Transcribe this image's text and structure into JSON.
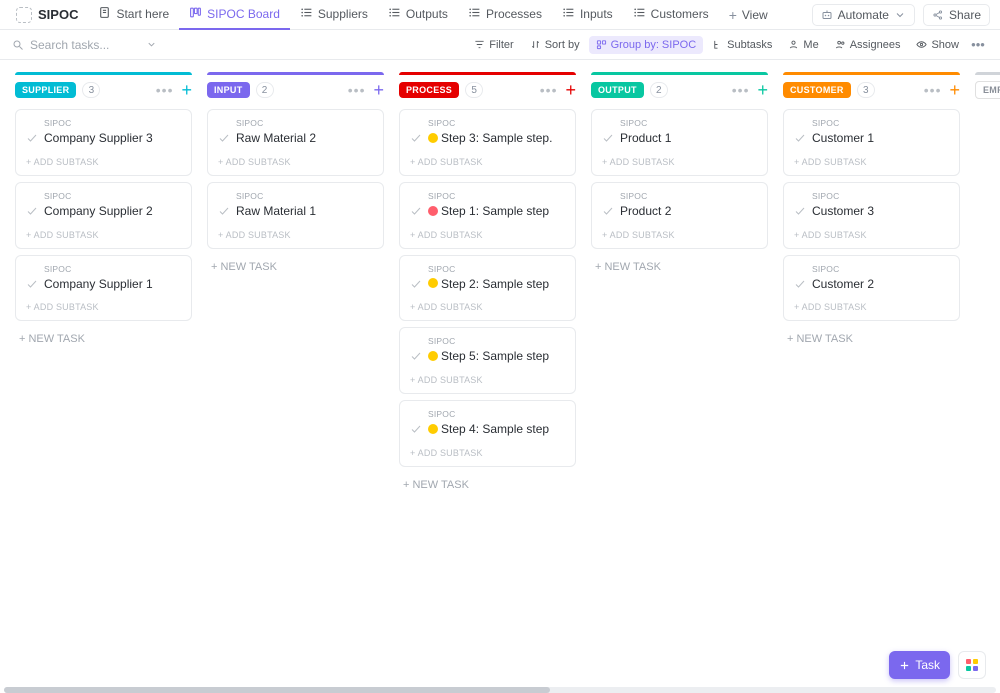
{
  "header": {
    "space_name": "SIPOC",
    "views": [
      {
        "label": "Start here",
        "type": "doc"
      },
      {
        "label": "SIPOC Board",
        "type": "board",
        "active": true
      },
      {
        "label": "Suppliers",
        "type": "list"
      },
      {
        "label": "Outputs",
        "type": "list"
      },
      {
        "label": "Processes",
        "type": "list"
      },
      {
        "label": "Inputs",
        "type": "list"
      },
      {
        "label": "Customers",
        "type": "list"
      }
    ],
    "add_view_label": "View",
    "automate_label": "Automate",
    "share_label": "Share"
  },
  "filters": {
    "search_placeholder": "Search tasks...",
    "filter": "Filter",
    "sort": "Sort by",
    "group": "Group by: SIPOC",
    "subtasks": "Subtasks",
    "me": "Me",
    "assignees": "Assignees",
    "show": "Show"
  },
  "ui": {
    "add_subtask": "ADD SUBTASK",
    "new_task": "NEW TASK",
    "crumb": "SIPOC"
  },
  "columns": [
    {
      "id": "supplier",
      "label": "SUPPLIER",
      "count": "3",
      "color": "#02bcd4",
      "plus": "#02bcd4",
      "cards": [
        {
          "title": "Company Supplier 3"
        },
        {
          "title": "Company Supplier 2"
        },
        {
          "title": "Company Supplier 1"
        }
      ]
    },
    {
      "id": "input",
      "label": "INPUT",
      "count": "2",
      "color": "#7b68ee",
      "plus": "#7b68ee",
      "cards": [
        {
          "title": "Raw Material 2"
        },
        {
          "title": "Raw Material 1"
        }
      ]
    },
    {
      "id": "process",
      "label": "PROCESS",
      "count": "5",
      "color": "#e50000",
      "plus": "#e50000",
      "cards": [
        {
          "title": "Step 3: Sample step.",
          "pri": "#ffcc00"
        },
        {
          "title": "Step 1: Sample step",
          "pri": "#ff5e6c"
        },
        {
          "title": "Step 2: Sample step",
          "pri": "#ffcc00"
        },
        {
          "title": "Step 5: Sample step",
          "pri": "#ffcc00"
        },
        {
          "title": "Step 4: Sample step",
          "pri": "#ffcc00"
        }
      ]
    },
    {
      "id": "output",
      "label": "OUTPUT",
      "count": "2",
      "color": "#08c7a1",
      "plus": "#08c7a1",
      "cards": [
        {
          "title": "Product 1"
        },
        {
          "title": "Product 2"
        }
      ]
    },
    {
      "id": "customer",
      "label": "CUSTOMER",
      "count": "3",
      "color": "#ff8b00",
      "plus": "#ff8b00",
      "cards": [
        {
          "title": "Customer 1"
        },
        {
          "title": "Customer 3"
        },
        {
          "title": "Customer 2"
        }
      ]
    },
    {
      "id": "empty",
      "label": "Empt",
      "count": "",
      "color": "#d0d4d9",
      "plus": "#87909e",
      "empty": true,
      "cards": []
    }
  ],
  "fab": {
    "task_label": "Task"
  }
}
